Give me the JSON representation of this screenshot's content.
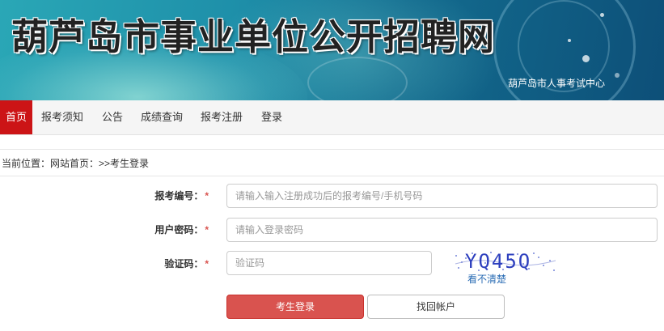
{
  "banner": {
    "title": "葫芦岛市事业单位公开招聘网",
    "subtitle": "葫芦岛市人事考试中心"
  },
  "nav": {
    "items": [
      {
        "label": "首页",
        "active": true
      },
      {
        "label": "报考须知",
        "active": false
      },
      {
        "label": "公告",
        "active": false
      },
      {
        "label": "成绩查询",
        "active": false
      },
      {
        "label": "报考注册",
        "active": false
      },
      {
        "label": "登录",
        "active": false
      }
    ]
  },
  "breadcrumb": {
    "text": "当前位置：网站首页：>>考生登录"
  },
  "form": {
    "exam_number": {
      "label": "报考编号：",
      "required_mark": "*",
      "placeholder": "请输入输入注册成功后的报考编号/手机号码",
      "value": ""
    },
    "password": {
      "label": "用户密码：",
      "required_mark": "*",
      "placeholder": "请输入登录密码",
      "value": ""
    },
    "captcha": {
      "label": "验证码：",
      "required_mark": "*",
      "placeholder": "验证码",
      "value": "",
      "image_text": "YQ45Q",
      "refresh_link": "看不清楚"
    },
    "login_button": "考生登录",
    "recover_button": "找回帐户"
  },
  "colors": {
    "nav_active": "#cc1416",
    "primary_button": "#d9534f",
    "required_mark": "#d9534f",
    "link": "#2b6db5"
  }
}
